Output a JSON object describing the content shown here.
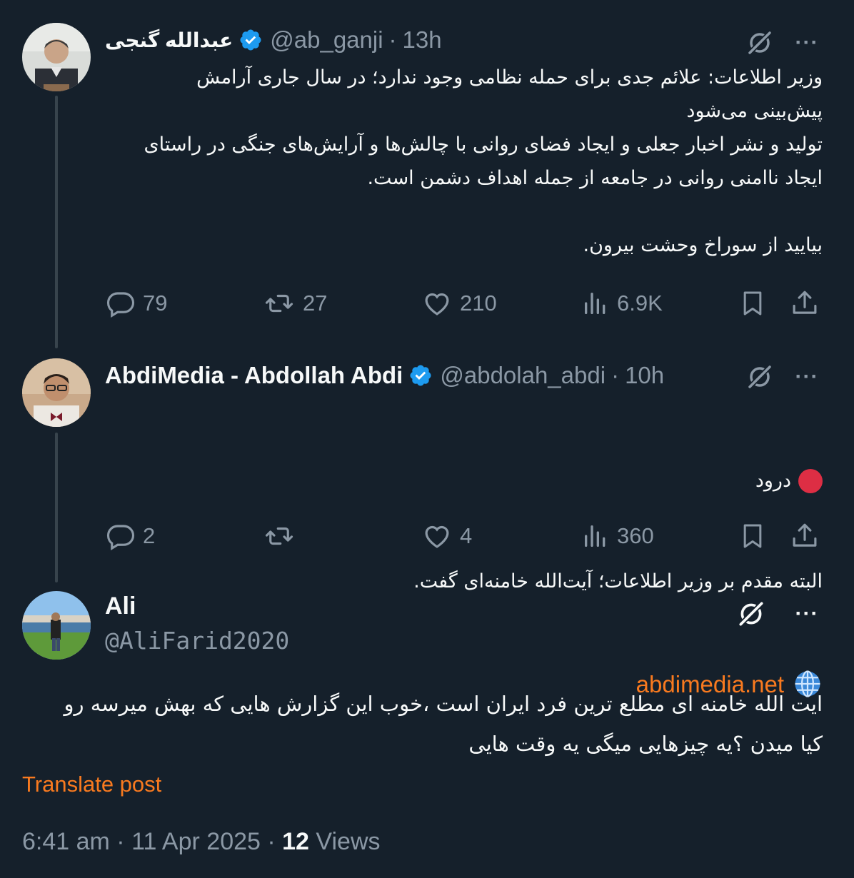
{
  "colors": {
    "background": "#15202b",
    "text": "#f7f9f9",
    "muted": "#8b98a5",
    "verified": "#1d9bf0",
    "link": "#f97a1f",
    "thread_line": "#38444d"
  },
  "tweets": [
    {
      "display_name": "عبدالله گنجی",
      "handle": "@ab_ganji",
      "time": "13h",
      "body": "وزیر اطلاعات: علائم جدی برای حمله نظامی وجود ندارد؛ در سال جاری آرامش\nپیش‌بینی می‌شود\nتولید و نشر اخبار جعلی و ایجاد فضای روانی با چالش‌ها و آرایش‌های جنگی در راستای\nایجاد ناامنی روانی در جامعه از جمله اهداف دشمن است.\n\nبیایید از سوراخ وحشت بیرون.",
      "replies": "79",
      "reposts": "27",
      "likes": "210",
      "views": "6.9K"
    },
    {
      "display_name": "AbdiMedia - Abdollah Abdi",
      "handle": "@abdolah_abdi",
      "time": "10h",
      "line1": "درود",
      "line2": "البته مقدم بر وزیر اطلاعات؛ آیت‌الله خامنه‌ای گفت.",
      "link": "abdimedia.net",
      "replies": "2",
      "reposts": "",
      "likes": "4",
      "views": "360"
    },
    {
      "display_name": "Ali",
      "handle": "@AliFarid2020",
      "body": "ایت الله خامنه ای مطلع ترین فرد ایران است ،خوب این گزارش هایی که بهش میرسه رو\nکیا میدن ؟یه چیزهایی میگی یه وقت هایی"
    }
  ],
  "translate_label": "Translate post",
  "footer": {
    "timestamp": "6:41 am · 11 Apr 2025 · ",
    "views_count": "12",
    "views_label": " Views"
  },
  "icons": [
    "grok-icon",
    "more-icon",
    "reply-icon",
    "repost-icon",
    "like-icon",
    "views-icon",
    "bookmark-icon",
    "share-icon",
    "verified-icon",
    "red-circle-icon",
    "globe-icon"
  ]
}
